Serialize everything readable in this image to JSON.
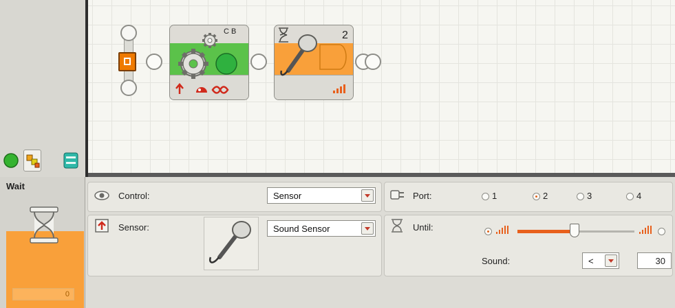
{
  "canvas": {
    "move_block": {
      "ports_label": "C B"
    },
    "wait_block": {
      "port_label": "2"
    }
  },
  "palette": {
    "tabs": [
      {
        "name": "common-palette"
      },
      {
        "name": "complete-palette"
      },
      {
        "name": "custom-palette"
      }
    ]
  },
  "config": {
    "title": "Wait",
    "status_strip_text": "0",
    "control": {
      "label": "Control:",
      "value": "Sensor"
    },
    "sensor": {
      "label": "Sensor:",
      "value": "Sound Sensor"
    },
    "port": {
      "label": "Port:",
      "options": [
        "1",
        "2",
        "3",
        "4"
      ],
      "selected": "2"
    },
    "until": {
      "label": "Until:",
      "slider_fraction": 0.49,
      "comparison": "<",
      "sound_label": "Sound:",
      "sound_value": "30"
    }
  },
  "colors": {
    "accent_orange": "#f9a03a",
    "move_green": "#5bc24a",
    "slider_orange": "#e8601c"
  }
}
